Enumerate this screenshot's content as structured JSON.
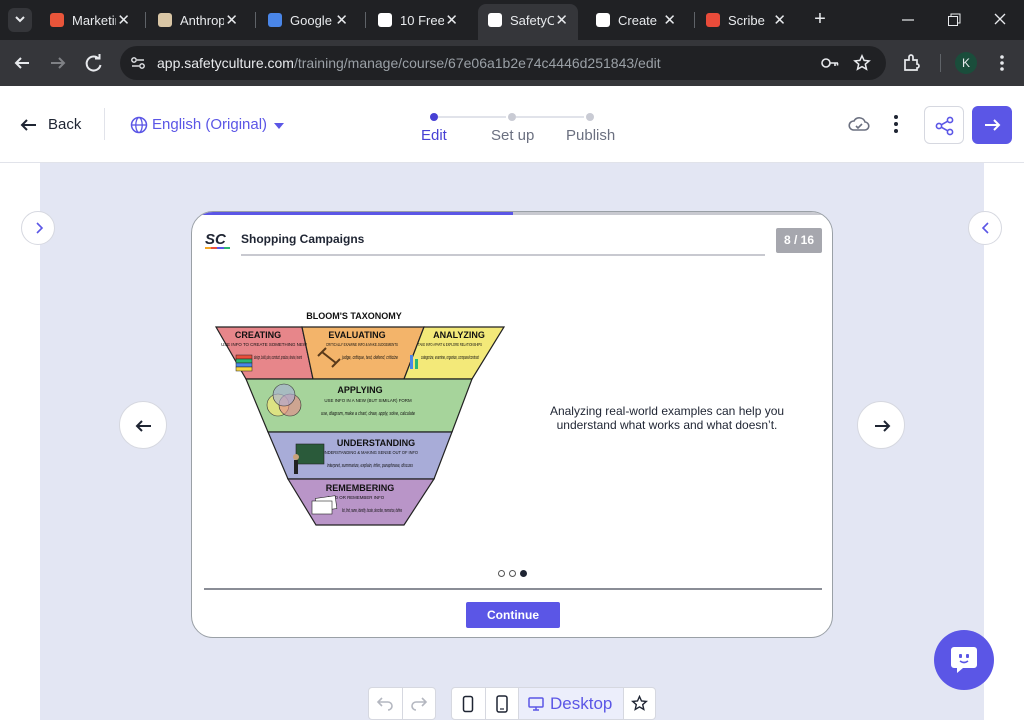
{
  "browser": {
    "tabs": [
      {
        "title": "Marketing",
        "favicon_color": "#e8553a"
      },
      {
        "title": "Anthropic",
        "favicon_color": "#d9c6a5"
      },
      {
        "title": "Google",
        "favicon_color": "#4a86e8"
      },
      {
        "title": "10 Free",
        "favicon_color": "#ffffff"
      },
      {
        "title": "SafetyCulture",
        "favicon_color": "#ffffff"
      },
      {
        "title": "Create",
        "favicon_color": "#ffffff"
      },
      {
        "title": "Scribe",
        "favicon_color": "#e84b3a"
      }
    ],
    "active_tab_index": 4,
    "url_host": "app.safetyculture.com",
    "url_path": "/training/manage/course/67e06a1b2e74c4446d251843/edit",
    "profile_initial": "K"
  },
  "header": {
    "back_label": "Back",
    "language_label": "English (Original)",
    "steps": [
      {
        "label": "Edit",
        "active": true
      },
      {
        "label": "Set up",
        "active": false
      },
      {
        "label": "Publish",
        "active": false
      }
    ]
  },
  "slide": {
    "course_title": "Shopping Campaigns",
    "page_indicator": "8 / 16",
    "progress_fraction": 0.5,
    "body_text": "Analyzing real-world examples can help you understand what works and what doesn’t.",
    "carousel_dots": 3,
    "carousel_active": 2,
    "continue_label": "Continue",
    "image": {
      "title": "BLOOM'S TAXONOMY",
      "levels": [
        {
          "name": "CREATING",
          "desc": "USE INFO TO CREATE SOMETHING NEW",
          "verbs": "design, build, plan, construct, produce, devise, invent",
          "color": "#e7868a"
        },
        {
          "name": "EVALUATING",
          "desc": "CRITICALLY EXAMINE INFO & MAKE JUDGEMENTS",
          "verbs": "judge, critique, test, defend, criticize",
          "color": "#f3b46a"
        },
        {
          "name": "ANALYZING",
          "desc": "TAKE INFO APART & EXPLORE RELATIONSHIPS",
          "verbs": "categorize, examine, organize, compare/contrast",
          "color": "#f3e979"
        },
        {
          "name": "APPLYING",
          "desc": "USE INFO IN A NEW (BUT SIMILAR) FORM",
          "verbs": "use, diagram, make a chart, draw, apply, solve, calculate",
          "color": "#a6d49b"
        },
        {
          "name": "UNDERSTANDING",
          "desc": "UNDERSTANDING & MAKING SENSE OUT OF INFO",
          "verbs": "interpret, summarize, explain, infer, paraphrase, discuss",
          "color": "#a8acd8"
        },
        {
          "name": "REMEMBERING",
          "desc": "FIND OR REMEMBER INFO",
          "verbs": "list, find, name, identify, locate, describe, memorize, define",
          "color": "#b995c8"
        }
      ]
    }
  },
  "bottom_bar": {
    "desktop_label": "Desktop"
  },
  "colors": {
    "accent": "#5b56e6",
    "canvas_bg": "#e3e6f3"
  }
}
